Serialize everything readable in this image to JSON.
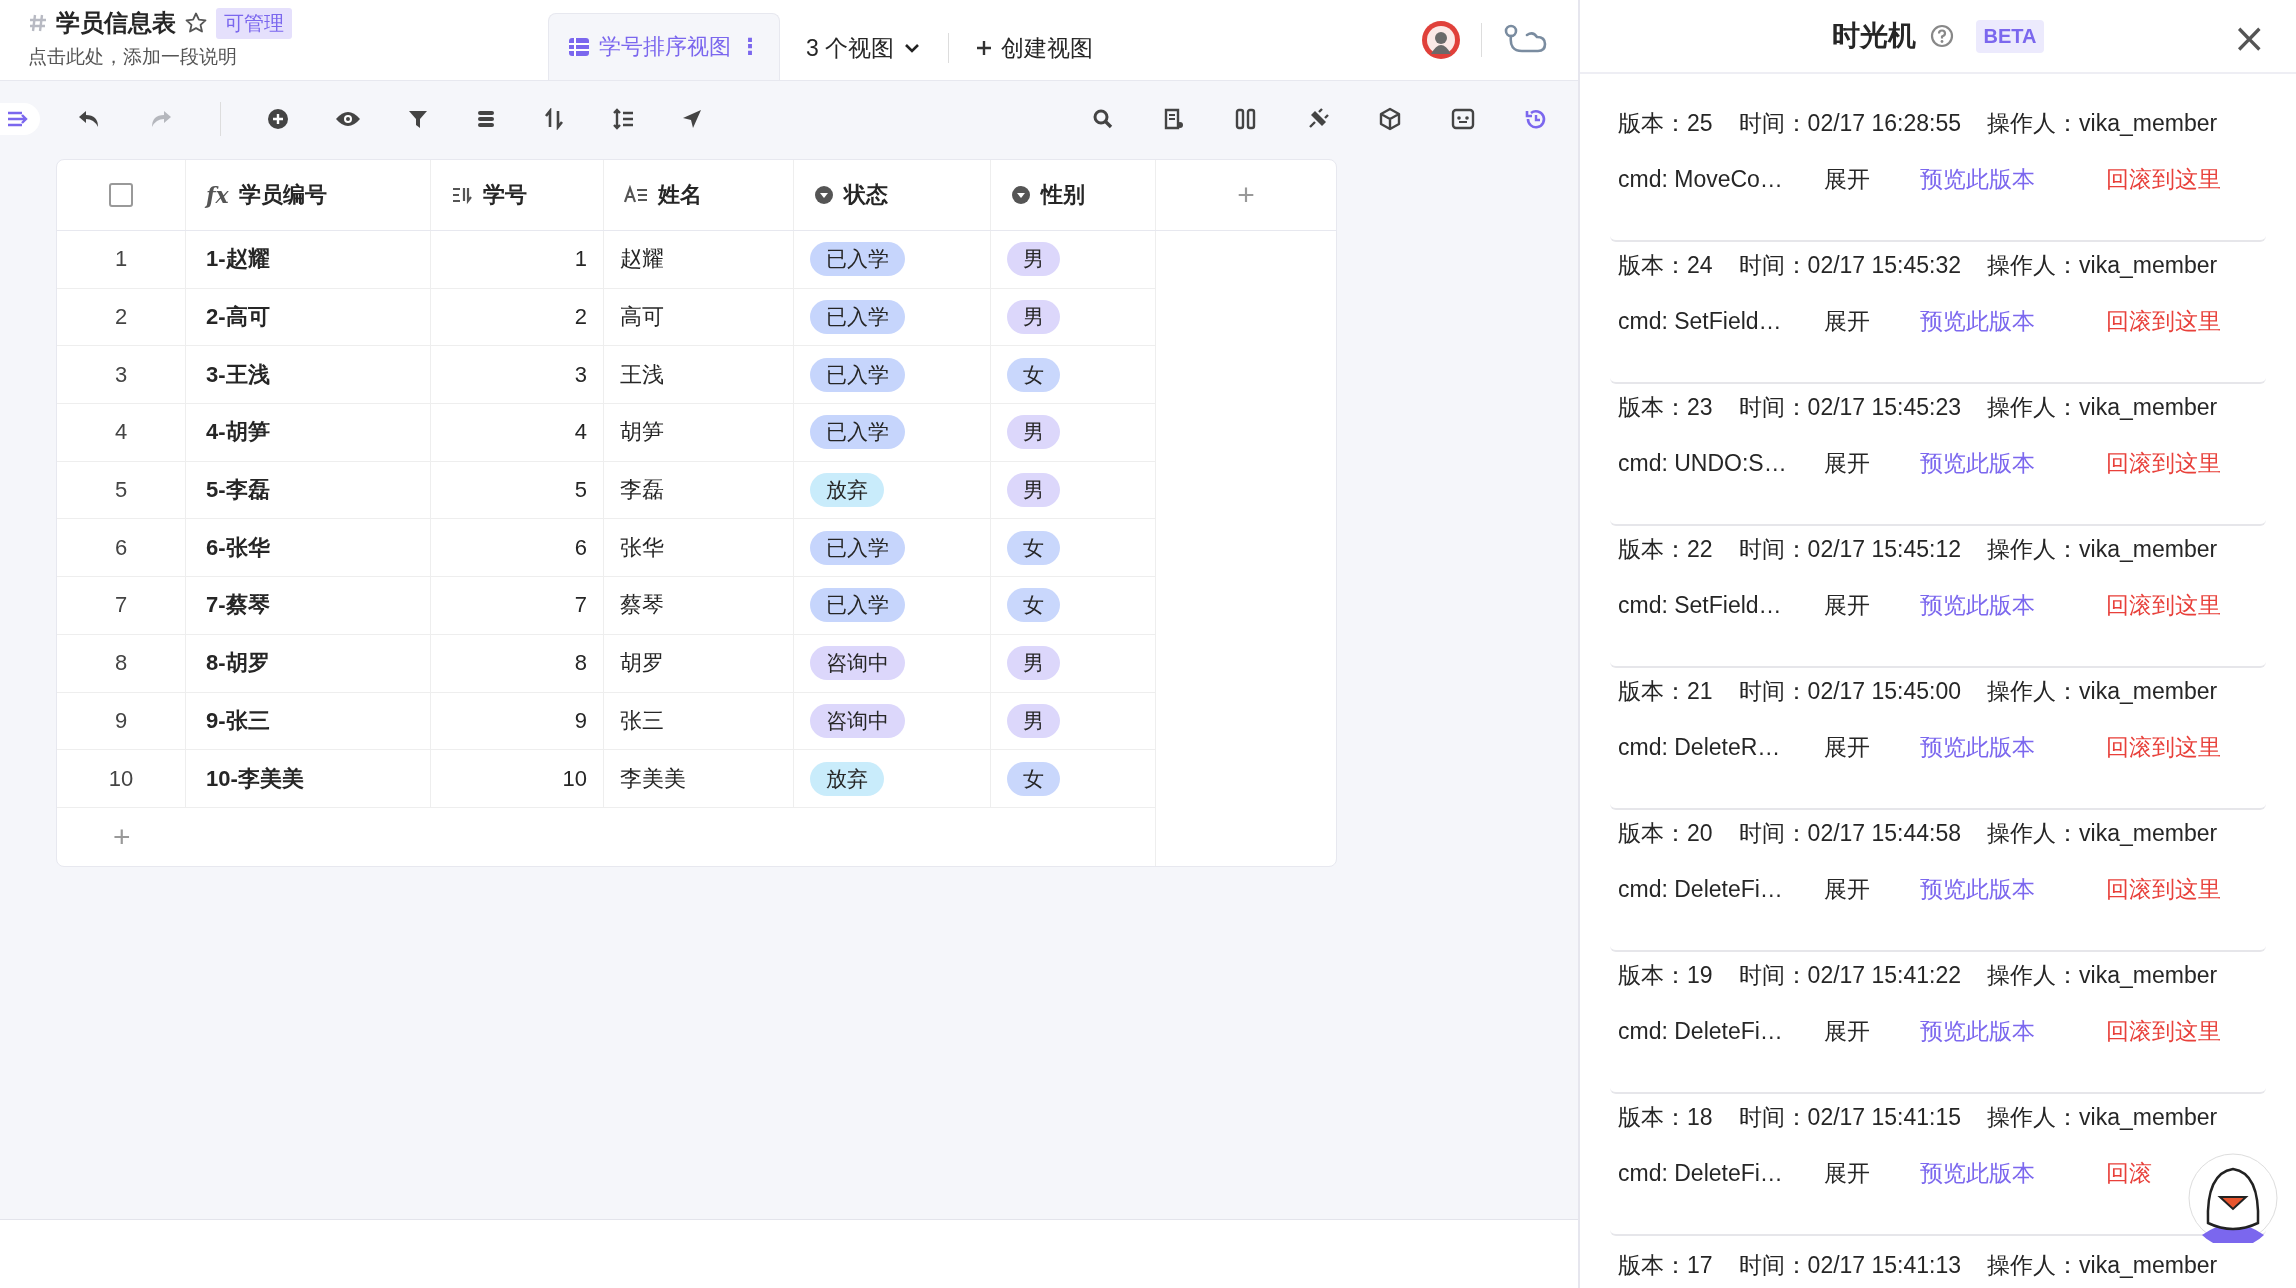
{
  "sheet": {
    "title": "学员信息表",
    "starred": false,
    "permission": "可管理",
    "description": "点击此处，添加一段说明"
  },
  "view_tabs": [
    {
      "label": "学号排序视图",
      "selected": true,
      "more": "⋮"
    }
  ],
  "views_dropdown": {
    "label": "3 个视图"
  },
  "create_view": {
    "label": "创建视图"
  },
  "table": {
    "columns": [
      {
        "kind": "select-all",
        "checked": false
      },
      {
        "kind": "formula",
        "glyph": "fx",
        "label": "学员编号"
      },
      {
        "kind": "autonumber",
        "label": "学号"
      },
      {
        "kind": "text",
        "label": "姓名"
      },
      {
        "kind": "single-select",
        "label": "状态"
      },
      {
        "kind": "single-select",
        "label": "性别"
      },
      {
        "kind": "add",
        "glyph": "+"
      }
    ],
    "rows": [
      {
        "index": "1",
        "code": "1-赵耀",
        "number": "1",
        "name": "赵耀",
        "status": {
          "label": "已入学",
          "color": "#c6d5fc"
        },
        "gender": {
          "label": "男",
          "color": "#dcd7fb"
        }
      },
      {
        "index": "2",
        "code": "2-高可",
        "number": "2",
        "name": "高可",
        "status": {
          "label": "已入学",
          "color": "#c6d5fc"
        },
        "gender": {
          "label": "男",
          "color": "#dcd7fb"
        }
      },
      {
        "index": "3",
        "code": "3-王浅",
        "number": "3",
        "name": "王浅",
        "status": {
          "label": "已入学",
          "color": "#c6d5fc"
        },
        "gender": {
          "label": "女",
          "color": "#c9d7fc"
        }
      },
      {
        "index": "4",
        "code": "4-胡笋",
        "number": "4",
        "name": "胡笋",
        "status": {
          "label": "已入学",
          "color": "#c6d5fc"
        },
        "gender": {
          "label": "男",
          "color": "#dcd7fb"
        }
      },
      {
        "index": "5",
        "code": "5-李磊",
        "number": "5",
        "name": "李磊",
        "status": {
          "label": "放弃",
          "color": "#c9ecfb"
        },
        "gender": {
          "label": "男",
          "color": "#dcd7fb"
        }
      },
      {
        "index": "6",
        "code": "6-张华",
        "number": "6",
        "name": "张华",
        "status": {
          "label": "已入学",
          "color": "#c6d5fc"
        },
        "gender": {
          "label": "女",
          "color": "#c9d7fc"
        }
      },
      {
        "index": "7",
        "code": "7-蔡琴",
        "number": "7",
        "name": "蔡琴",
        "status": {
          "label": "已入学",
          "color": "#c6d5fc"
        },
        "gender": {
          "label": "女",
          "color": "#c9d7fc"
        }
      },
      {
        "index": "8",
        "code": "8-胡罗",
        "number": "8",
        "name": "胡罗",
        "status": {
          "label": "咨询中",
          "color": "#dcd7fb"
        },
        "gender": {
          "label": "男",
          "color": "#dcd7fb"
        }
      },
      {
        "index": "9",
        "code": "9-张三",
        "number": "9",
        "name": "张三",
        "status": {
          "label": "咨询中",
          "color": "#dcd7fb"
        },
        "gender": {
          "label": "男",
          "color": "#dcd7fb"
        }
      },
      {
        "index": "10",
        "code": "10-李美美",
        "number": "10",
        "name": "李美美",
        "status": {
          "label": "放弃",
          "color": "#c9ecfb"
        },
        "gender": {
          "label": "女",
          "color": "#c9d7fc"
        }
      }
    ],
    "add_row": "+"
  },
  "time_machine": {
    "title": "时光机",
    "badge": "BETA",
    "close": "×",
    "versions": [
      {
        "version": "版本：25",
        "time": "时间：02/17 16:28:55",
        "operator": "操作人：vika_member",
        "cmd": "cmd: MoveCo…",
        "expand": "展开",
        "preview": "预览此版本",
        "rollback": "回滚到这里"
      },
      {
        "version": "版本：24",
        "time": "时间：02/17 15:45:32",
        "operator": "操作人：vika_member",
        "cmd": "cmd: SetField…",
        "expand": "展开",
        "preview": "预览此版本",
        "rollback": "回滚到这里"
      },
      {
        "version": "版本：23",
        "time": "时间：02/17 15:45:23",
        "operator": "操作人：vika_member",
        "cmd": "cmd: UNDO:S…",
        "expand": "展开",
        "preview": "预览此版本",
        "rollback": "回滚到这里"
      },
      {
        "version": "版本：22",
        "time": "时间：02/17 15:45:12",
        "operator": "操作人：vika_member",
        "cmd": "cmd: SetField…",
        "expand": "展开",
        "preview": "预览此版本",
        "rollback": "回滚到这里"
      },
      {
        "version": "版本：21",
        "time": "时间：02/17 15:45:00",
        "operator": "操作人：vika_member",
        "cmd": "cmd: DeleteR…",
        "expand": "展开",
        "preview": "预览此版本",
        "rollback": "回滚到这里"
      },
      {
        "version": "版本：20",
        "time": "时间：02/17 15:44:58",
        "operator": "操作人：vika_member",
        "cmd": "cmd: DeleteFi…",
        "expand": "展开",
        "preview": "预览此版本",
        "rollback": "回滚到这里"
      },
      {
        "version": "版本：19",
        "time": "时间：02/17 15:41:22",
        "operator": "操作人：vika_member",
        "cmd": "cmd: DeleteFi…",
        "expand": "展开",
        "preview": "预览此版本",
        "rollback": "回滚到这里"
      },
      {
        "version": "版本：18",
        "time": "时间：02/17 15:41:15",
        "operator": "操作人：vika_member",
        "cmd": "cmd: DeleteFi…",
        "expand": "展开",
        "preview": "预览此版本",
        "rollback": "回滚"
      },
      {
        "version": "版本：17",
        "time": "时间：02/17 15:41:13",
        "operator": "操作人：vika_member"
      }
    ]
  }
}
